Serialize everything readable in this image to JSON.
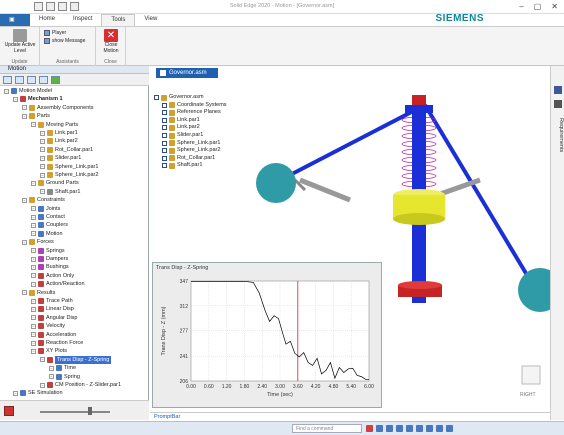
{
  "window": {
    "title": "Solid Edge 2020 - Motion - [Governor.asm]"
  },
  "tabs": [
    "Home",
    "Inspect",
    "Tools",
    "View"
  ],
  "brand": "SIEMENS",
  "ribbon": {
    "update": {
      "label": "Update Active Level",
      "group": "Update"
    },
    "assistants": {
      "player": "Player",
      "show_message": "show Message",
      "group": "Assistants"
    },
    "close": {
      "label": "Close Motion",
      "group": "Close"
    }
  },
  "panel": {
    "title": "Motion"
  },
  "tree": [
    {
      "label": "Motion Model",
      "level": 0,
      "icon": "#4a78c0"
    },
    {
      "label": "Mechanism 1",
      "level": 1,
      "icon": "#c04040",
      "bold": true
    },
    {
      "label": "Assembly Components",
      "level": 2,
      "icon": "#d0a030"
    },
    {
      "label": "Parts",
      "level": 2,
      "icon": "#d0a030"
    },
    {
      "label": "Moving Parts",
      "level": 3,
      "icon": "#d0a030"
    },
    {
      "label": "Link.par1",
      "level": 4,
      "icon": "#d0a030"
    },
    {
      "label": "Link.par2",
      "level": 4,
      "icon": "#d0a030"
    },
    {
      "label": "Rot_Collar.par1",
      "level": 4,
      "icon": "#d0a030"
    },
    {
      "label": "Slider.par1",
      "level": 4,
      "icon": "#d0a030"
    },
    {
      "label": "Sphere_Link.par1",
      "level": 4,
      "icon": "#d0a030"
    },
    {
      "label": "Sphere_Link.par2",
      "level": 4,
      "icon": "#d0a030"
    },
    {
      "label": "Ground Parts",
      "level": 3,
      "icon": "#d0a030"
    },
    {
      "label": "Shaft.par1",
      "level": 4,
      "icon": "#8a8a8a"
    },
    {
      "label": "Constraints",
      "level": 2,
      "icon": "#d0a030"
    },
    {
      "label": "Joints",
      "level": 3,
      "icon": "#4a78c0"
    },
    {
      "label": "Contact",
      "level": 3,
      "icon": "#4a78c0"
    },
    {
      "label": "Couplers",
      "level": 3,
      "icon": "#4a78c0"
    },
    {
      "label": "Motion",
      "level": 3,
      "icon": "#4a78c0"
    },
    {
      "label": "Forces",
      "level": 2,
      "icon": "#d0a030"
    },
    {
      "label": "Springs",
      "level": 3,
      "icon": "#b040b0"
    },
    {
      "label": "Dampers",
      "level": 3,
      "icon": "#b040b0"
    },
    {
      "label": "Bushings",
      "level": 3,
      "icon": "#b040b0"
    },
    {
      "label": "Action Only",
      "level": 3,
      "icon": "#c04040"
    },
    {
      "label": "Action/Reaction",
      "level": 3,
      "icon": "#c04040"
    },
    {
      "label": "Results",
      "level": 2,
      "icon": "#d0a030"
    },
    {
      "label": "Trace Path",
      "level": 3,
      "icon": "#c04040"
    },
    {
      "label": "Linear Disp",
      "level": 3,
      "icon": "#c04040"
    },
    {
      "label": "Angular Disp",
      "level": 3,
      "icon": "#c04040"
    },
    {
      "label": "Velocity",
      "level": 3,
      "icon": "#c04040"
    },
    {
      "label": "Acceleration",
      "level": 3,
      "icon": "#c04040"
    },
    {
      "label": "Reaction Force",
      "level": 3,
      "icon": "#c04040"
    },
    {
      "label": "XY Plots",
      "level": 3,
      "icon": "#c04040"
    },
    {
      "label": "Trans Disp - Z-Spring",
      "level": 4,
      "icon": "#c04040",
      "selected": true
    },
    {
      "label": "Time",
      "level": 5,
      "icon": "#4a78c0"
    },
    {
      "label": "Spring",
      "level": 5,
      "icon": "#4a78c0"
    },
    {
      "label": "CM Position - Z-Slider.par1",
      "level": 4,
      "icon": "#c04040"
    },
    {
      "label": "SE Simulation",
      "level": 1,
      "icon": "#4a78c0"
    }
  ],
  "document": {
    "tab": "Governor.asm"
  },
  "viewtree": [
    {
      "label": "Governor.asm",
      "level": 0
    },
    {
      "label": "Coordinate Systems",
      "level": 1
    },
    {
      "label": "Reference Planes",
      "level": 1
    },
    {
      "label": "Link.par1",
      "level": 1
    },
    {
      "label": "Link.par2",
      "level": 1
    },
    {
      "label": "Slider.par1",
      "level": 1
    },
    {
      "label": "Sphere_Link.par1",
      "level": 1
    },
    {
      "label": "Sphere_Link.par2",
      "level": 1
    },
    {
      "label": "Rot_Collar.par1",
      "level": 1
    },
    {
      "label": "Shaft.par1",
      "level": 1
    }
  ],
  "side": {
    "requirements": "Requirements"
  },
  "promptbar": "PromptBar",
  "taskbar": {
    "search": "Find a command"
  },
  "colors": {
    "accent": "#2060b0",
    "brand": "#0b8a99",
    "ball": "#2e9ba6",
    "collar": "#e6e62e",
    "base": "#c62424",
    "spring": "#c0229a",
    "shaft": "#1a2fd6"
  },
  "chart_data": {
    "type": "line",
    "title": "Trans Disp - Z-Spring",
    "xlabel": "Time (sec)",
    "ylabel": "Trans Disp - Z (mm)",
    "xlim": [
      0,
      6
    ],
    "ylim": [
      206,
      347
    ],
    "xticks": [
      0,
      0.6,
      1.2,
      1.8,
      2.4,
      3.0,
      3.6,
      4.2,
      4.8,
      5.4,
      6.0
    ],
    "xtick_labels": [
      "0.00",
      "0.60",
      "1.20",
      "1.80",
      "2.40",
      "3.00",
      "3.60",
      "4.20",
      "4.80",
      "5.40",
      "6.00"
    ],
    "yticks": [
      206,
      241,
      277,
      312,
      347
    ],
    "cursor_x": 3.6,
    "series": [
      {
        "x": [
          0,
          0.5,
          1.0,
          1.5,
          1.9,
          2.1,
          2.3,
          2.5,
          2.65,
          2.8,
          2.95,
          3.1,
          3.2,
          3.35,
          3.5,
          3.65,
          3.8,
          3.95,
          4.1,
          4.25,
          4.4,
          4.55,
          4.7,
          4.85,
          5.0,
          5.15,
          5.3,
          5.45,
          5.6,
          5.75,
          5.9,
          6.0
        ],
        "y": [
          346,
          346,
          346,
          346,
          346,
          345,
          330,
          305,
          290,
          298,
          294,
          272,
          258,
          262,
          245,
          240,
          246,
          232,
          228,
          238,
          216,
          221,
          232,
          210,
          225,
          218,
          223,
          224,
          214,
          212,
          208,
          208
        ]
      }
    ]
  }
}
